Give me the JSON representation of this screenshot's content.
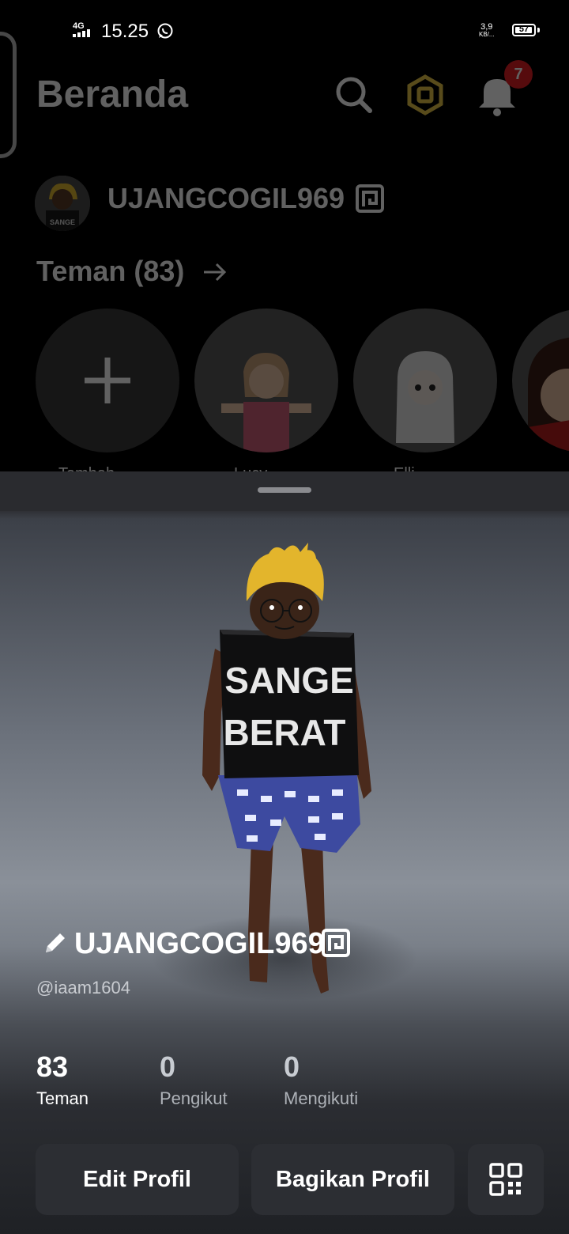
{
  "status_bar": {
    "network": "4G",
    "time": "15.25",
    "speed_value": "3,9",
    "speed_unit": "KB/...",
    "battery": "57"
  },
  "home": {
    "title": "Beranda",
    "notification_count": "7",
    "username": "UJANGCOGIL969",
    "avatar_shirt_text": "SANGE",
    "friends_label": "Teman (83)",
    "friend_names": [
      "Tambah",
      "Lucy",
      "Elli",
      ""
    ]
  },
  "profile": {
    "display_name": "UJANGCOGIL969",
    "handle": "@iaam1604",
    "avatar_shirt_line1": "SANGE",
    "avatar_shirt_line2": "BERAT",
    "stats": [
      {
        "value": "83",
        "label": "Teman"
      },
      {
        "value": "0",
        "label": "Pengikut"
      },
      {
        "value": "0",
        "label": "Mengikuti"
      }
    ],
    "edit_button": "Edit Profil",
    "share_button": "Bagikan Profil"
  },
  "colors": {
    "sheet_background": "#2c2d31",
    "button_background": "#2c2e33",
    "notification_badge": "#e31e24",
    "online_dot": "#2fbf71"
  },
  "icons": {
    "edit": "pencil-icon",
    "verified": "premium-badge-icon",
    "qr": "qr-code-icon",
    "search": "search-icon",
    "currency": "robux-icon",
    "notifications": "bell-icon"
  }
}
